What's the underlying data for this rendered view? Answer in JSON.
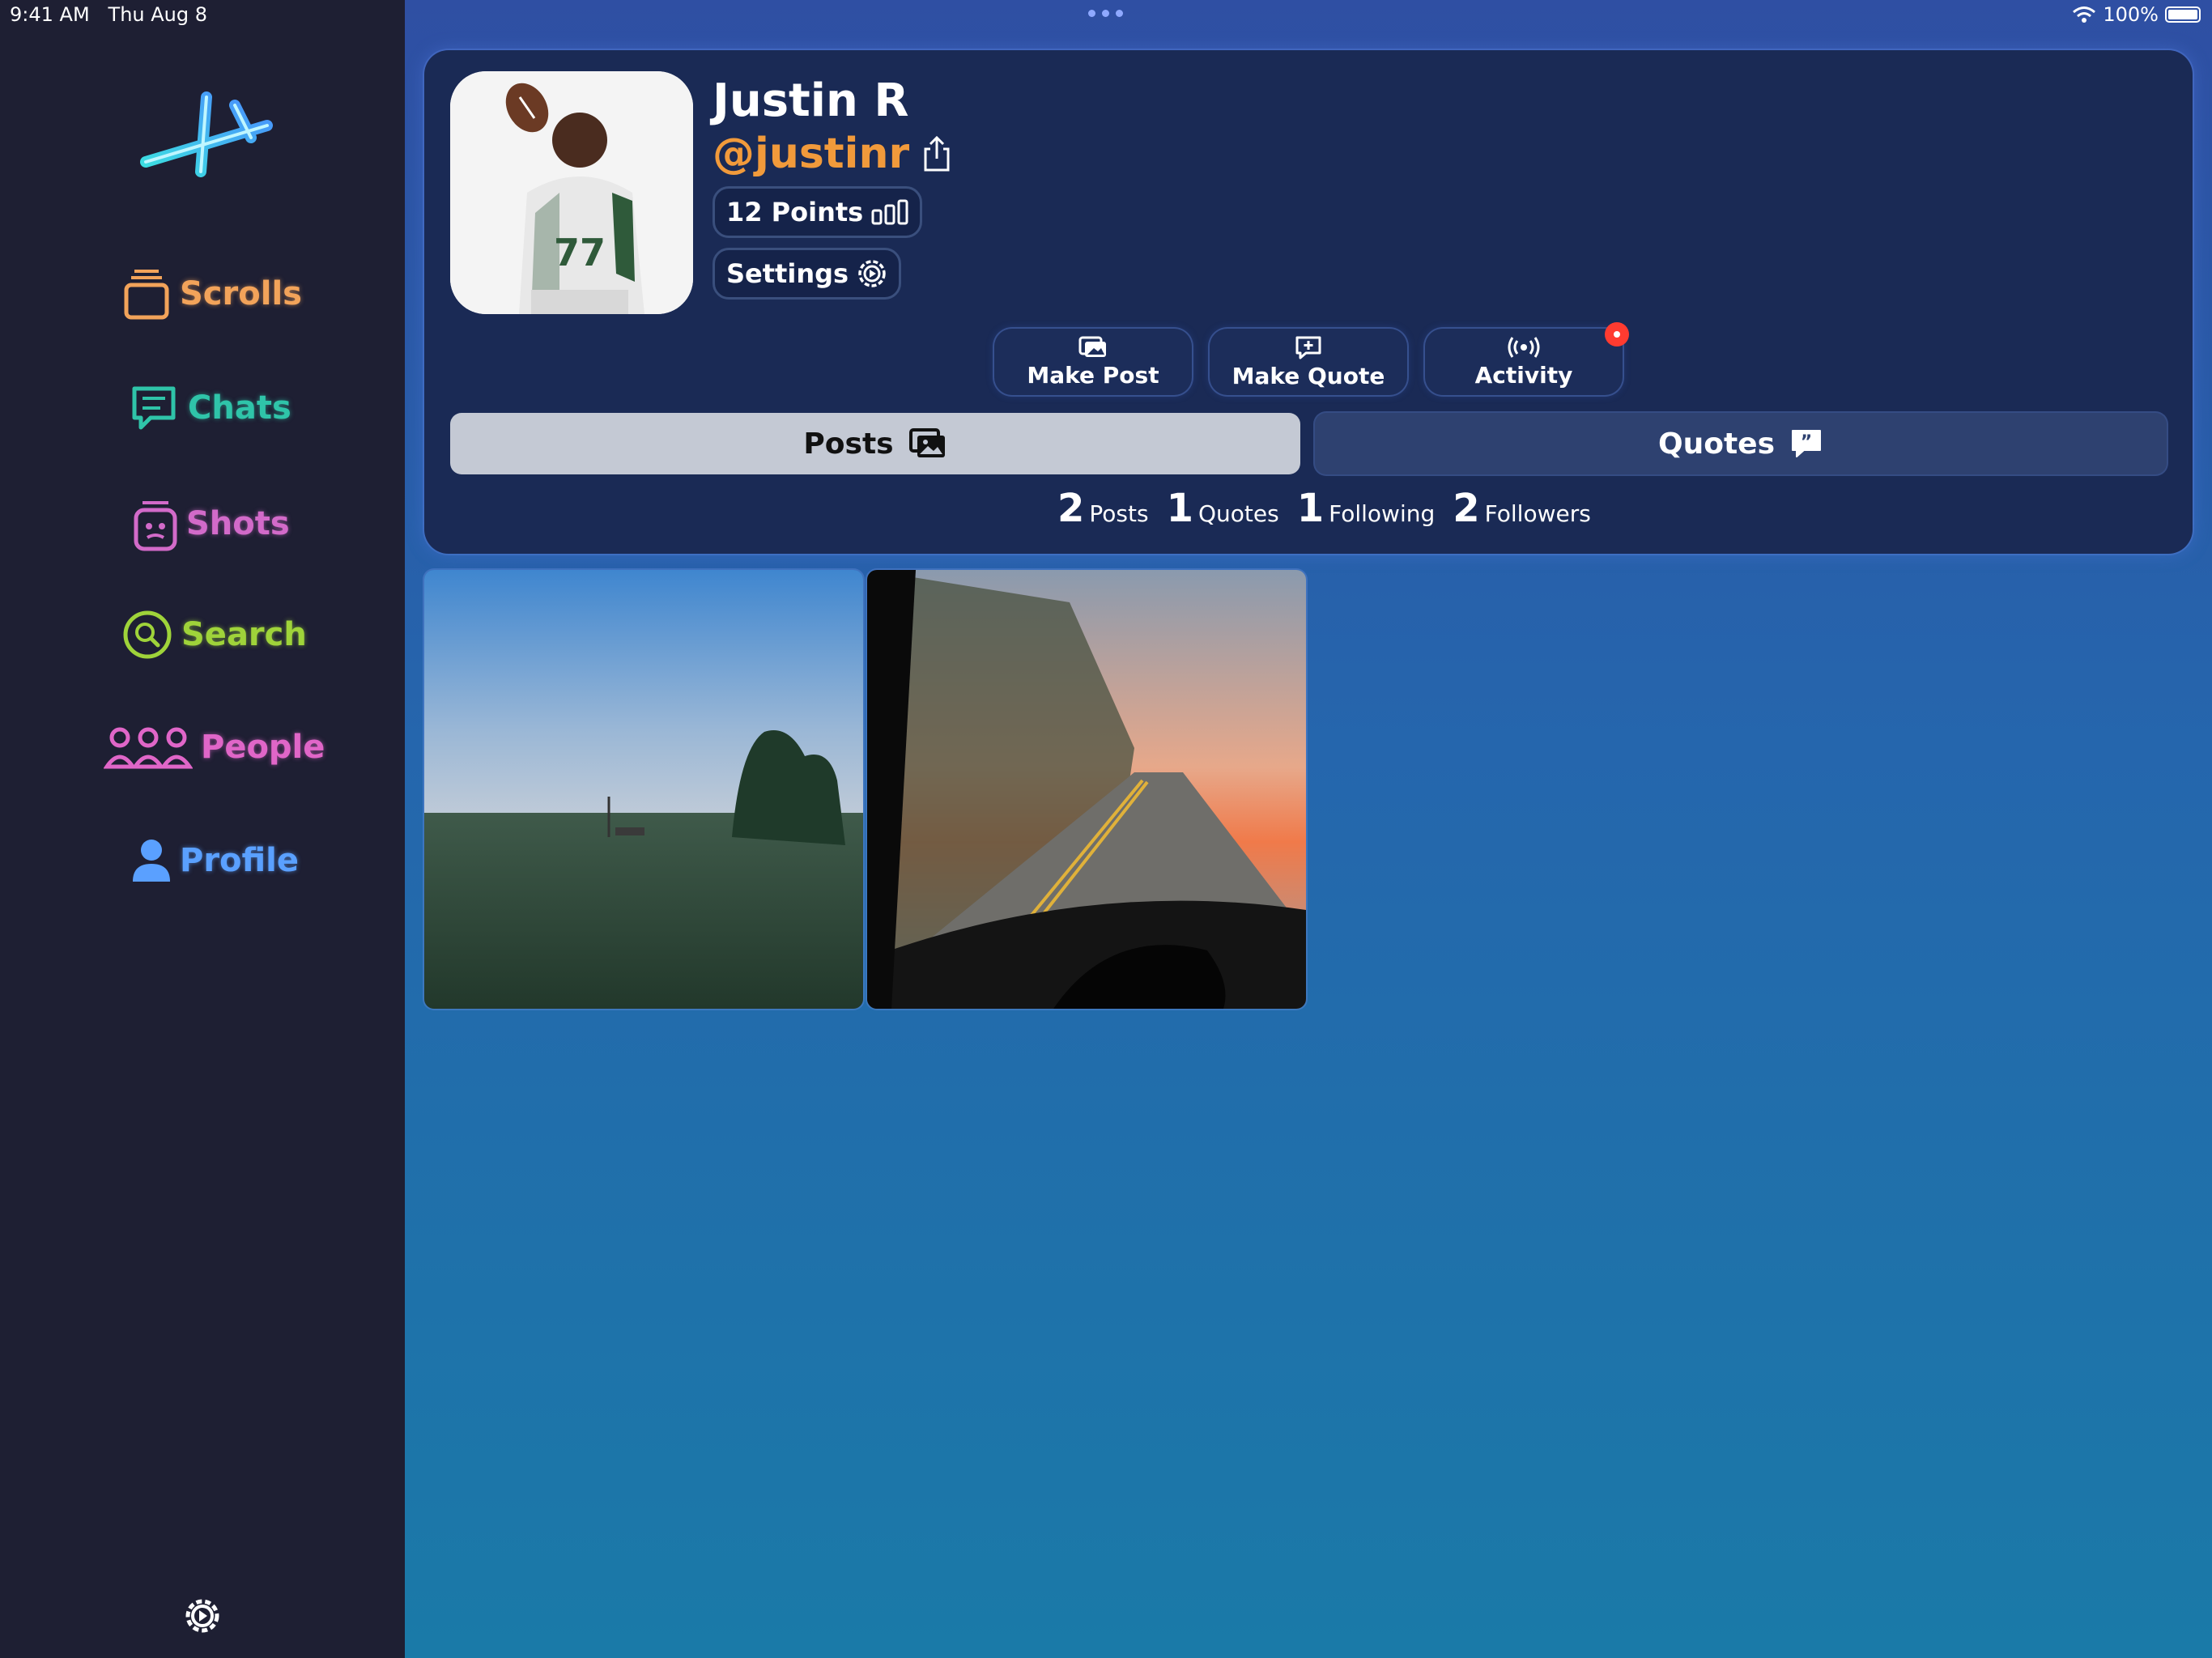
{
  "status_bar": {
    "time": "9:41 AM",
    "date": "Thu Aug 8",
    "battery": "100%",
    "wifi_icon": "wifi-icon"
  },
  "sidebar": {
    "items": [
      {
        "label": "Scrolls",
        "icon": "scrolls-icon",
        "color": "#f2a35a"
      },
      {
        "label": "Chats",
        "icon": "chat-bubble-icon",
        "color": "#2fc4a9"
      },
      {
        "label": "Shots",
        "icon": "shots-icon",
        "color": "#d26ac9"
      },
      {
        "label": "Search",
        "icon": "search-icon",
        "color": "#9fd33a"
      },
      {
        "label": "People",
        "icon": "people-icon",
        "color": "#e066c8"
      },
      {
        "label": "Profile",
        "icon": "person-icon",
        "color": "#5aa0ff"
      }
    ],
    "settings_icon": "gear-icon"
  },
  "profile": {
    "name": "Justin R",
    "handle": "@justinr",
    "points": "12 Points",
    "settings_label": "Settings",
    "handle_color": "#f19a3b"
  },
  "actions": {
    "make_post": "Make Post",
    "make_quote": "Make Quote",
    "activity": "Activity"
  },
  "tabs": {
    "posts": "Posts",
    "quotes": "Quotes",
    "active": "Posts"
  },
  "stats": [
    {
      "count": "2",
      "label": "Posts"
    },
    {
      "count": "1",
      "label": "Quotes"
    },
    {
      "count": "1",
      "label": "Following"
    },
    {
      "count": "2",
      "label": "Followers"
    }
  ],
  "posts": [
    {
      "description": "foggy-field-photo"
    },
    {
      "description": "sunset-road-photo"
    }
  ]
}
